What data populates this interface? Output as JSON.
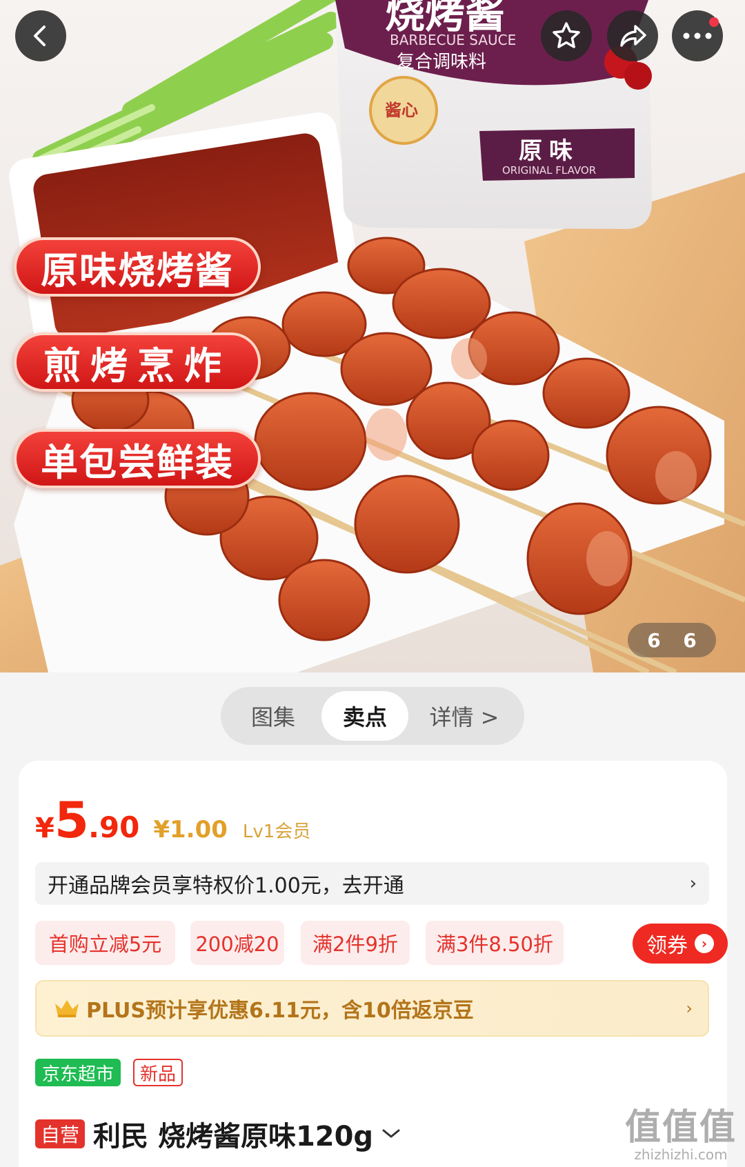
{
  "hero": {
    "tags": [
      "原味烧烤酱",
      "煎烤烹炸",
      "单包尝鲜装"
    ],
    "pager": {
      "current": "6",
      "total": "6"
    },
    "package": {
      "title": "烧烤酱",
      "english": "BARBECUE SAUCE",
      "subtitle": "复合调味料",
      "flavor_cn": "原味",
      "flavor_en": "ORIGINAL FLAVOR",
      "seal": "酱心"
    }
  },
  "tabs": [
    {
      "label": "图集"
    },
    {
      "label": "卖点"
    },
    {
      "label": "详情 >"
    }
  ],
  "price": {
    "symbol": "¥",
    "integer": "5",
    "decimal": ".90",
    "member_price": "¥1.00",
    "member_level": "Lv1会员"
  },
  "member_banner": {
    "text": "开通品牌会员享特权价1.00元，去开通",
    "arrow": "›"
  },
  "promos": [
    "首购立减5元",
    "200减20",
    "满2件9折",
    "满3件8.50折"
  ],
  "coupon": {
    "label": "领券"
  },
  "plus_banner": {
    "text": "PLUS预计享优惠6.11元，含10倍返京豆",
    "arrow": "›"
  },
  "badges": {
    "jd": "京东超市",
    "new": "新品"
  },
  "product": {
    "self_badge": "自营",
    "title": "利民 烧烤酱原味120g"
  },
  "watermark": {
    "logo": "值值值",
    "url": "zhizhizhi.com"
  },
  "colors": {
    "price_red": "#f2270c",
    "coupon_red": "#ef2a22",
    "jd_green": "#1ebc52",
    "plus_gold": "#b3741a"
  }
}
